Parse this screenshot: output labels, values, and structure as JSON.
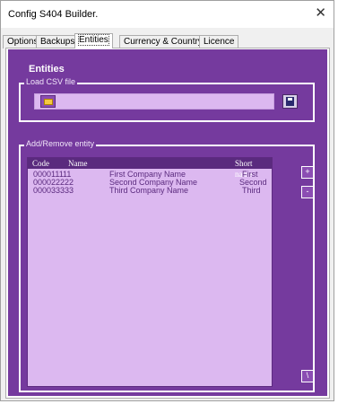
{
  "window": {
    "title": "Config S404 Builder.",
    "close_glyph": "✕"
  },
  "tabs": [
    {
      "label": "Options",
      "active": false
    },
    {
      "label": "Backups",
      "active": false
    },
    {
      "label": "Entities",
      "active": true
    },
    {
      "label": "Currency & Country",
      "active": false
    },
    {
      "label": "Licence",
      "active": false
    }
  ],
  "panel": {
    "heading": "Entities",
    "load_csv": {
      "legend": "Load CSV file",
      "path_value": "",
      "browse_icon": "folder-icon",
      "load_icon": "save-icon"
    },
    "add_remove": {
      "legend": "Add/Remove entity",
      "columns": [
        "Code",
        "Name",
        "Short name"
      ],
      "rows": [
        {
          "code": "000011111",
          "name": "First Company Name",
          "short": "First"
        },
        {
          "code": "000022222",
          "name": "Second Company Name",
          "short": "Second"
        },
        {
          "code": "000033333",
          "name": "Third Company Name",
          "short": "Third"
        }
      ],
      "add_label": "+",
      "remove_label": "-",
      "bottom_label": "\\"
    }
  },
  "colors": {
    "panel": "#753a9e",
    "list_bg": "#dcb8f0",
    "header_bg": "#5a2a7e",
    "list_text": "#5a2a7e"
  }
}
